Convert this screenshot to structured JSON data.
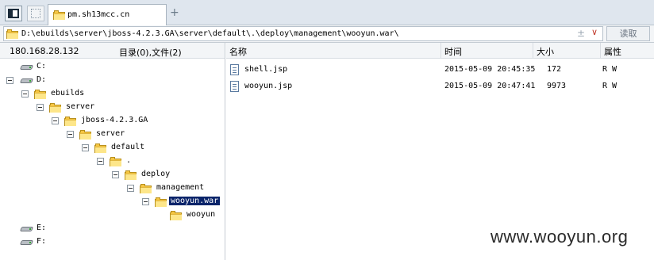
{
  "tab": {
    "title": "pm.sh13mcc.cn",
    "add_label": "+"
  },
  "address": {
    "path": "D:\\ebuilds\\server\\jboss-4.2.3.GA\\server\\default\\.\\deploy\\management\\wooyun.war\\",
    "plus": "±",
    "chevron": "∨",
    "read_label": "读取"
  },
  "left_header": {
    "ip": "180.168.28.132",
    "stats": "目录(0),文件(2)"
  },
  "tree": {
    "c": "C:",
    "d": "D:",
    "ebuilds": "ebuilds",
    "server": "server",
    "jboss": "jboss-4.2.3.GA",
    "server2": "server",
    "default": "default",
    "dot": ".",
    "deploy": "deploy",
    "management": "management",
    "war": "wooyun.war",
    "wooyun": "wooyun",
    "e": "E:",
    "f": "F:"
  },
  "columns": {
    "name": "名称",
    "time": "时间",
    "size": "大小",
    "attr": "属性"
  },
  "files": [
    {
      "name": "shell.jsp",
      "time": "2015-05-09 20:45:35",
      "size": "172",
      "attr": "R W"
    },
    {
      "name": "wooyun.jsp",
      "time": "2015-05-09 20:47:41",
      "size": "9973",
      "attr": "R W"
    }
  ],
  "watermark": "www.wooyun.org"
}
